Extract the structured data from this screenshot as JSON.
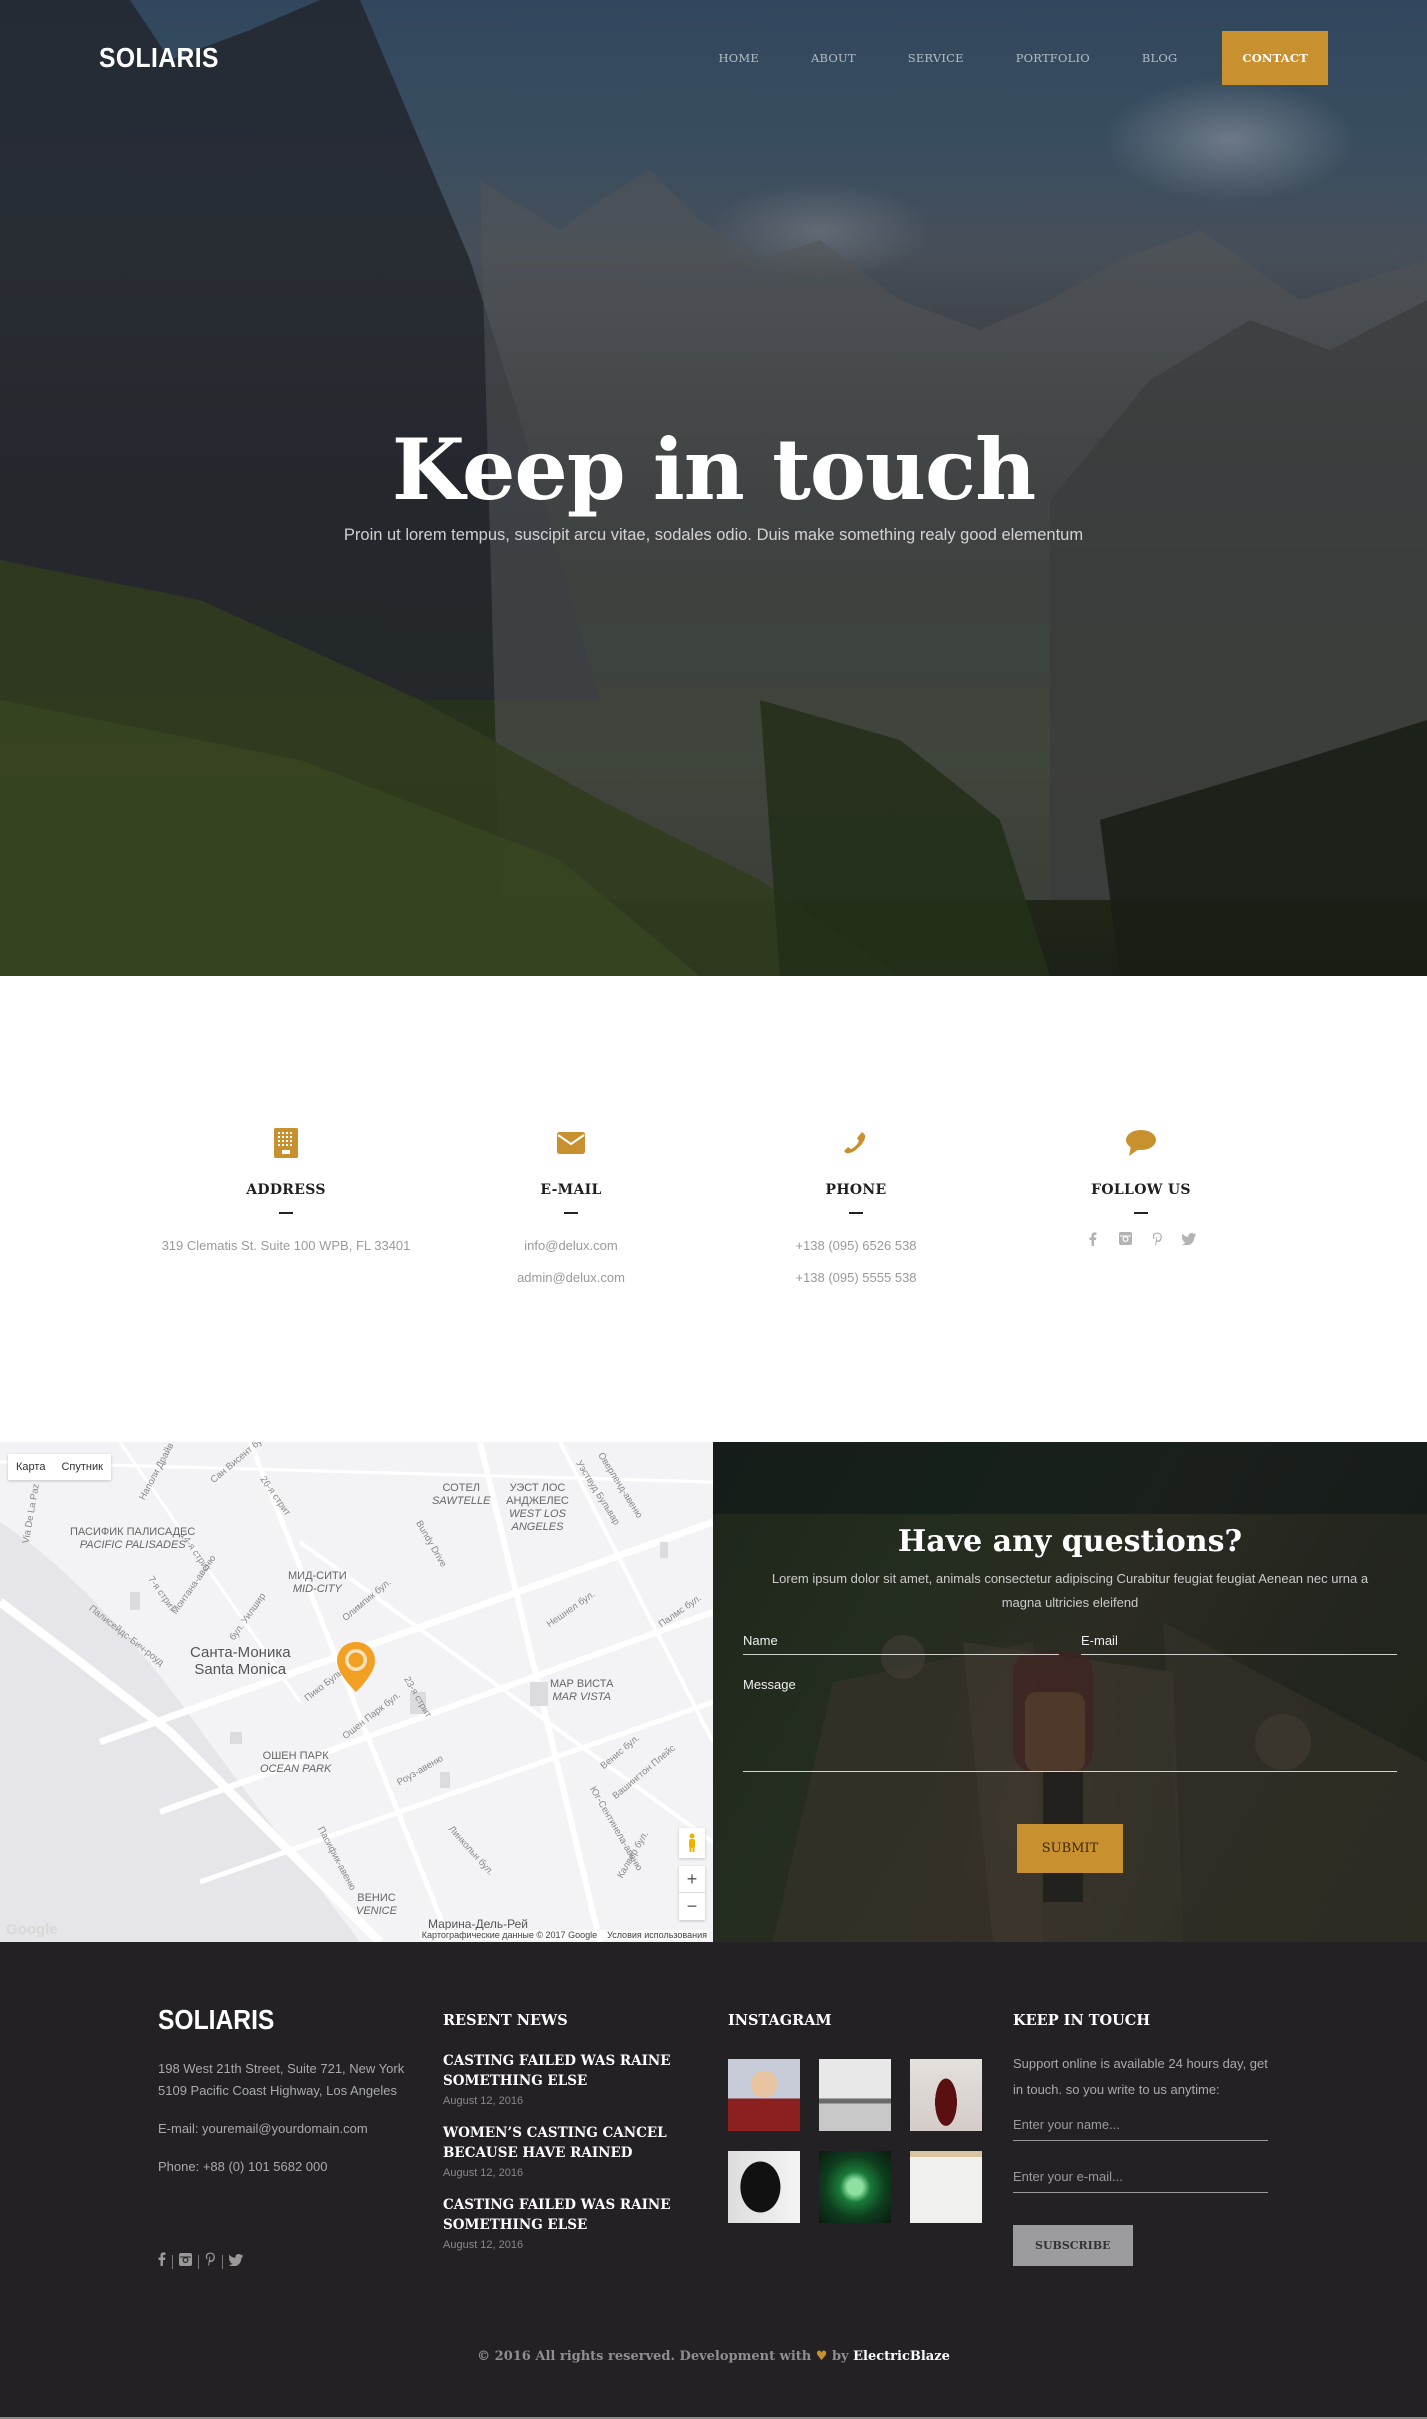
{
  "header": {
    "logo": "SOLIARIS",
    "nav": [
      {
        "label": "HOME",
        "active": false
      },
      {
        "label": "ABOUT",
        "active": false
      },
      {
        "label": "SERVICE",
        "active": false
      },
      {
        "label": "PORTFOLIO",
        "active": false
      },
      {
        "label": "BLOG",
        "active": false
      },
      {
        "label": "CONTACT",
        "active": true
      }
    ]
  },
  "hero": {
    "title": "Keep in touch",
    "subtitle": "Proin ut lorem tempus, suscipit arcu vitae, sodales odio. Duis make something realy good elementum"
  },
  "info": [
    {
      "icon": "building-icon",
      "title": "ADDRESS",
      "lines": [
        "319 Clematis St. Suite 100 WPB, FL 33401"
      ]
    },
    {
      "icon": "envelope-icon",
      "title": "E-MAIL",
      "lines": [
        "info@delux.com",
        "admin@delux.com"
      ]
    },
    {
      "icon": "phone-icon",
      "title": "PHONE",
      "lines": [
        "+138 (095) 6526 538",
        "+138 (095) 5555 538"
      ]
    },
    {
      "icon": "speech-bubble-icon",
      "title": "FOLLOW US",
      "socials": [
        "facebook-icon",
        "instagram-icon",
        "pinterest-icon",
        "twitter-icon"
      ]
    }
  ],
  "map": {
    "type_buttons": [
      "Карта",
      "Спутник"
    ],
    "areas": [
      {
        "ru": "ПАСИФИК ПАЛИСАДЕС",
        "en": "PACIFIC PALISADES"
      },
      {
        "ru": "СОТЕЛ",
        "en": "SAWTELLE"
      },
      {
        "ru": "УЭСТ ЛОС АНДЖЕЛЕС",
        "en": "WEST LOS ANGELES"
      },
      {
        "ru": "МИД-СИТИ",
        "en": "MID-CITY"
      },
      {
        "ru": "Санта-Моника",
        "en": "Santa Monica"
      },
      {
        "ru": "МАР ВИСТА",
        "en": "MAR VISTA"
      },
      {
        "ru": "ОШЕН ПАРК",
        "en": "OCEAN PARK"
      },
      {
        "ru": "ВЕНИС",
        "en": "VENICE"
      },
      {
        "ru": "Марина-Дель-Рей",
        "en": ""
      }
    ],
    "streets": [
      "Сан Висент бул.",
      "26-я стрит",
      "14-я стрит",
      "7-я стрит",
      "Монтана-авеню",
      "бул. Уилшир",
      "Палисейдс-Бич-роуд",
      "Олимпик бул.",
      "Bundy Drive",
      "Нешнел бул.",
      "Палмс бул.",
      "Пико Бульвар",
      "Ошен Парк бул.",
      "23-я стрит",
      "Роуз-авеню",
      "Венис бул.",
      "Вашингтон Плейс",
      "Юг-Сентинела-авеню",
      "Линкольн бул.",
      "Пасифик-авеню",
      "Калвер бул.",
      "Уэствуд Бульвар",
      "Оверленд-авеню",
      "Наполи Драйв",
      "Via De La Paz"
    ],
    "zoom_in": "+",
    "zoom_out": "−",
    "attribution": "Картографические данные © 2017 Google",
    "terms": "Условия использования",
    "google_logo": "Google"
  },
  "contact_form": {
    "title": "Have any questions?",
    "description": "Lorem ipsum dolor sit amet, animals consectetur adipiscing Curabitur feugiat feugiat Aenean nec urna a magna ultricies eleifend",
    "name_placeholder": "Name",
    "email_placeholder": "E-mail",
    "message_placeholder": "Message",
    "submit_label": "SUBMIT"
  },
  "footer": {
    "logo": "SOLIARIS",
    "address_lines": [
      "198 West 21th Street, Suite 721, New York",
      "5109 Pacific Coast Highway, Los Angeles"
    ],
    "email": "E-mail: youremail@yourdomain.com",
    "phone": "Phone: +88 (0) 101 5682 000",
    "socials": [
      "facebook-icon",
      "instagram-icon",
      "pinterest-icon",
      "twitter-icon"
    ],
    "news_heading": "RESENT NEWS",
    "news": [
      {
        "title": "CASTING FAILED WAS RAINE SOMETHING ELSE",
        "date": "August 12, 2016"
      },
      {
        "title": "WOMEN’S CASTING CANCEL BECAUSE HAVE RAINED",
        "date": "August 12, 2016"
      },
      {
        "title": "CASTING FAILED WAS RAINE SOMETHING ELSE",
        "date": "August 12, 2016"
      }
    ],
    "instagram_heading": "INSTAGRAM",
    "instagram_images": [
      "boy-portrait",
      "bare-trees",
      "liquor-bottle",
      "candle-jar",
      "green-glass",
      "notebook-pen"
    ],
    "newsletter_heading": "KEEP IN TOUCH",
    "newsletter_text": "Support online is available 24 hours day, get in touch. so you write to us anytime:",
    "name_placeholder": "Enter your name...",
    "email_placeholder": "Enter your e-mail...",
    "subscribe_label": "SUBSCRIBE",
    "copyright_prefix": "© 2016 All rights reserved. Development with",
    "copyright_by": "by",
    "copyright_brand": "ElectricBlaze"
  },
  "colors": {
    "accent": "#c99030",
    "footer_bg": "#232124",
    "heading_dark": "#1f1f1f",
    "muted_text": "#9a9a9a"
  }
}
